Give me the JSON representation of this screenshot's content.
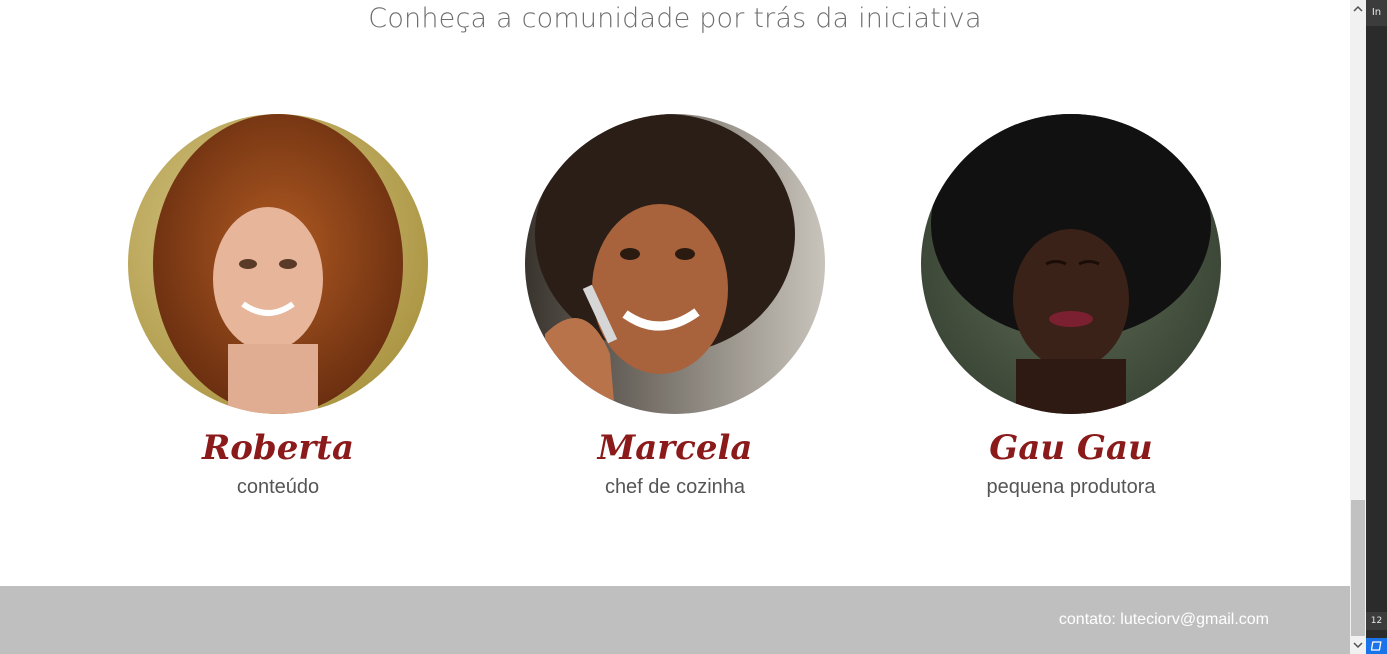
{
  "section": {
    "title": "Conheça a comunidade por trás da iniciativa"
  },
  "members": [
    {
      "name": "Roberta",
      "role": "conteúdo"
    },
    {
      "name": "Marcela",
      "role": "chef de cozinha"
    },
    {
      "name": "Gau Gau",
      "role": "pequena produtora"
    }
  ],
  "footer": {
    "contact": "contato: luteciorv@gmail.com"
  },
  "devtools": {
    "tab_label": "In",
    "counter": "12"
  },
  "colors": {
    "accent": "#8b1a1a",
    "footer_bg": "#bfbfbf",
    "text_muted": "#555555"
  }
}
